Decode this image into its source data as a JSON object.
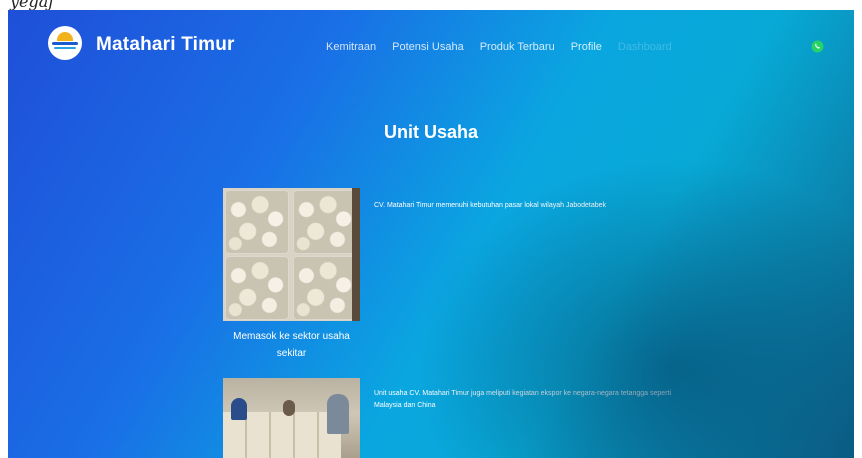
{
  "top_strip": {
    "text": "yegaj"
  },
  "brand": {
    "name": "Matahari Timur"
  },
  "nav": {
    "items": [
      {
        "label": "Kemitraan",
        "faded": false
      },
      {
        "label": "Potensi Usaha",
        "faded": false
      },
      {
        "label": "Produk Terbaru",
        "faded": false
      },
      {
        "label": "Profile",
        "faded": false
      },
      {
        "label": "Dashboard",
        "faded": true
      }
    ]
  },
  "section": {
    "title": "Unit Usaha"
  },
  "units": [
    {
      "caption": "Memasok ke sektor usaha sekitar",
      "description": "CV. Matahari Timur memenuhi kebutuhan pasar lokal wilayah Jabodetabek"
    },
    {
      "caption": "",
      "description": "Unit usaha CV. Matahari Timur juga meliputi kegiatan ekspor ke negara-negara tetangga seperti Malaysia dan China"
    }
  ],
  "colors": {
    "gradient_start": "#1f4fd8",
    "gradient_mid": "#0aa6e0",
    "gradient_end": "#0b5f88",
    "text": "#ffffff",
    "whatsapp": "#25d366"
  },
  "icons": {
    "logo": "matahari-timur-logo",
    "whatsapp": "whatsapp-icon"
  }
}
